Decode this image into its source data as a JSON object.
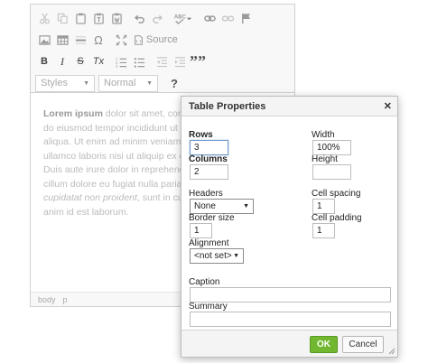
{
  "toolbar": {
    "source_label": "Source",
    "styles_label": "Styles",
    "format_label": "Normal",
    "bold": "B",
    "italic": "I",
    "strike": "S",
    "clear_format": "Tx",
    "blockquote": "””",
    "help": "?"
  },
  "editor": {
    "lines": [
      {
        "lead": "Lorem ipsum",
        "text": " dolor sit amet, consect"
      },
      {
        "text": "do eiusmod tempor incididunt ut labo"
      },
      {
        "text": "aliqua. Ut enim ad minim veniam, qu"
      },
      {
        "text": "ullamco laboris nisi ut aliquip ex ea c"
      },
      {
        "text": "Duis aute irure dolor in reprehenderit"
      },
      {
        "text": "cillum dolore eu fugiat nulla pariatur. "
      },
      {
        "italic": "cupidatat non proident",
        "text": ", sunt in culpa"
      },
      {
        "text": "anim id est laborum."
      }
    ],
    "status_path": [
      "body",
      "p"
    ]
  },
  "dialog": {
    "title": "Table Properties",
    "rows_label": "Rows",
    "rows_value": "3",
    "columns_label": "Columns",
    "columns_value": "2",
    "width_label": "Width",
    "width_value": "100%",
    "height_label": "Height",
    "height_value": "",
    "headers_label": "Headers",
    "headers_value": "None",
    "cell_spacing_label": "Cell spacing",
    "cell_spacing_value": "1",
    "border_size_label": "Border size",
    "border_size_value": "1",
    "cell_padding_label": "Cell padding",
    "cell_padding_value": "1",
    "alignment_label": "Alignment",
    "alignment_value": "<not set>",
    "caption_label": "Caption",
    "caption_value": "",
    "summary_label": "Summary",
    "summary_value": "",
    "ok_label": "OK",
    "cancel_label": "Cancel"
  },
  "colors": {
    "ok_button": "#71b830",
    "toolbar_bg": "#f8f8f8",
    "dialog_header_bg": "#f4f4f4"
  },
  "icons": [
    "cut-icon",
    "copy-icon",
    "paste-icon",
    "paste-text-icon",
    "paste-word-icon",
    "undo-icon",
    "redo-icon",
    "spellcheck-icon",
    "link-icon",
    "unlink-icon",
    "anchor-icon",
    "image-icon",
    "table-icon",
    "horizontal-line-icon",
    "special-char-icon",
    "maximize-icon",
    "source-icon",
    "numbered-list-icon",
    "bulleted-list-icon",
    "outdent-icon",
    "indent-icon",
    "close-icon"
  ]
}
